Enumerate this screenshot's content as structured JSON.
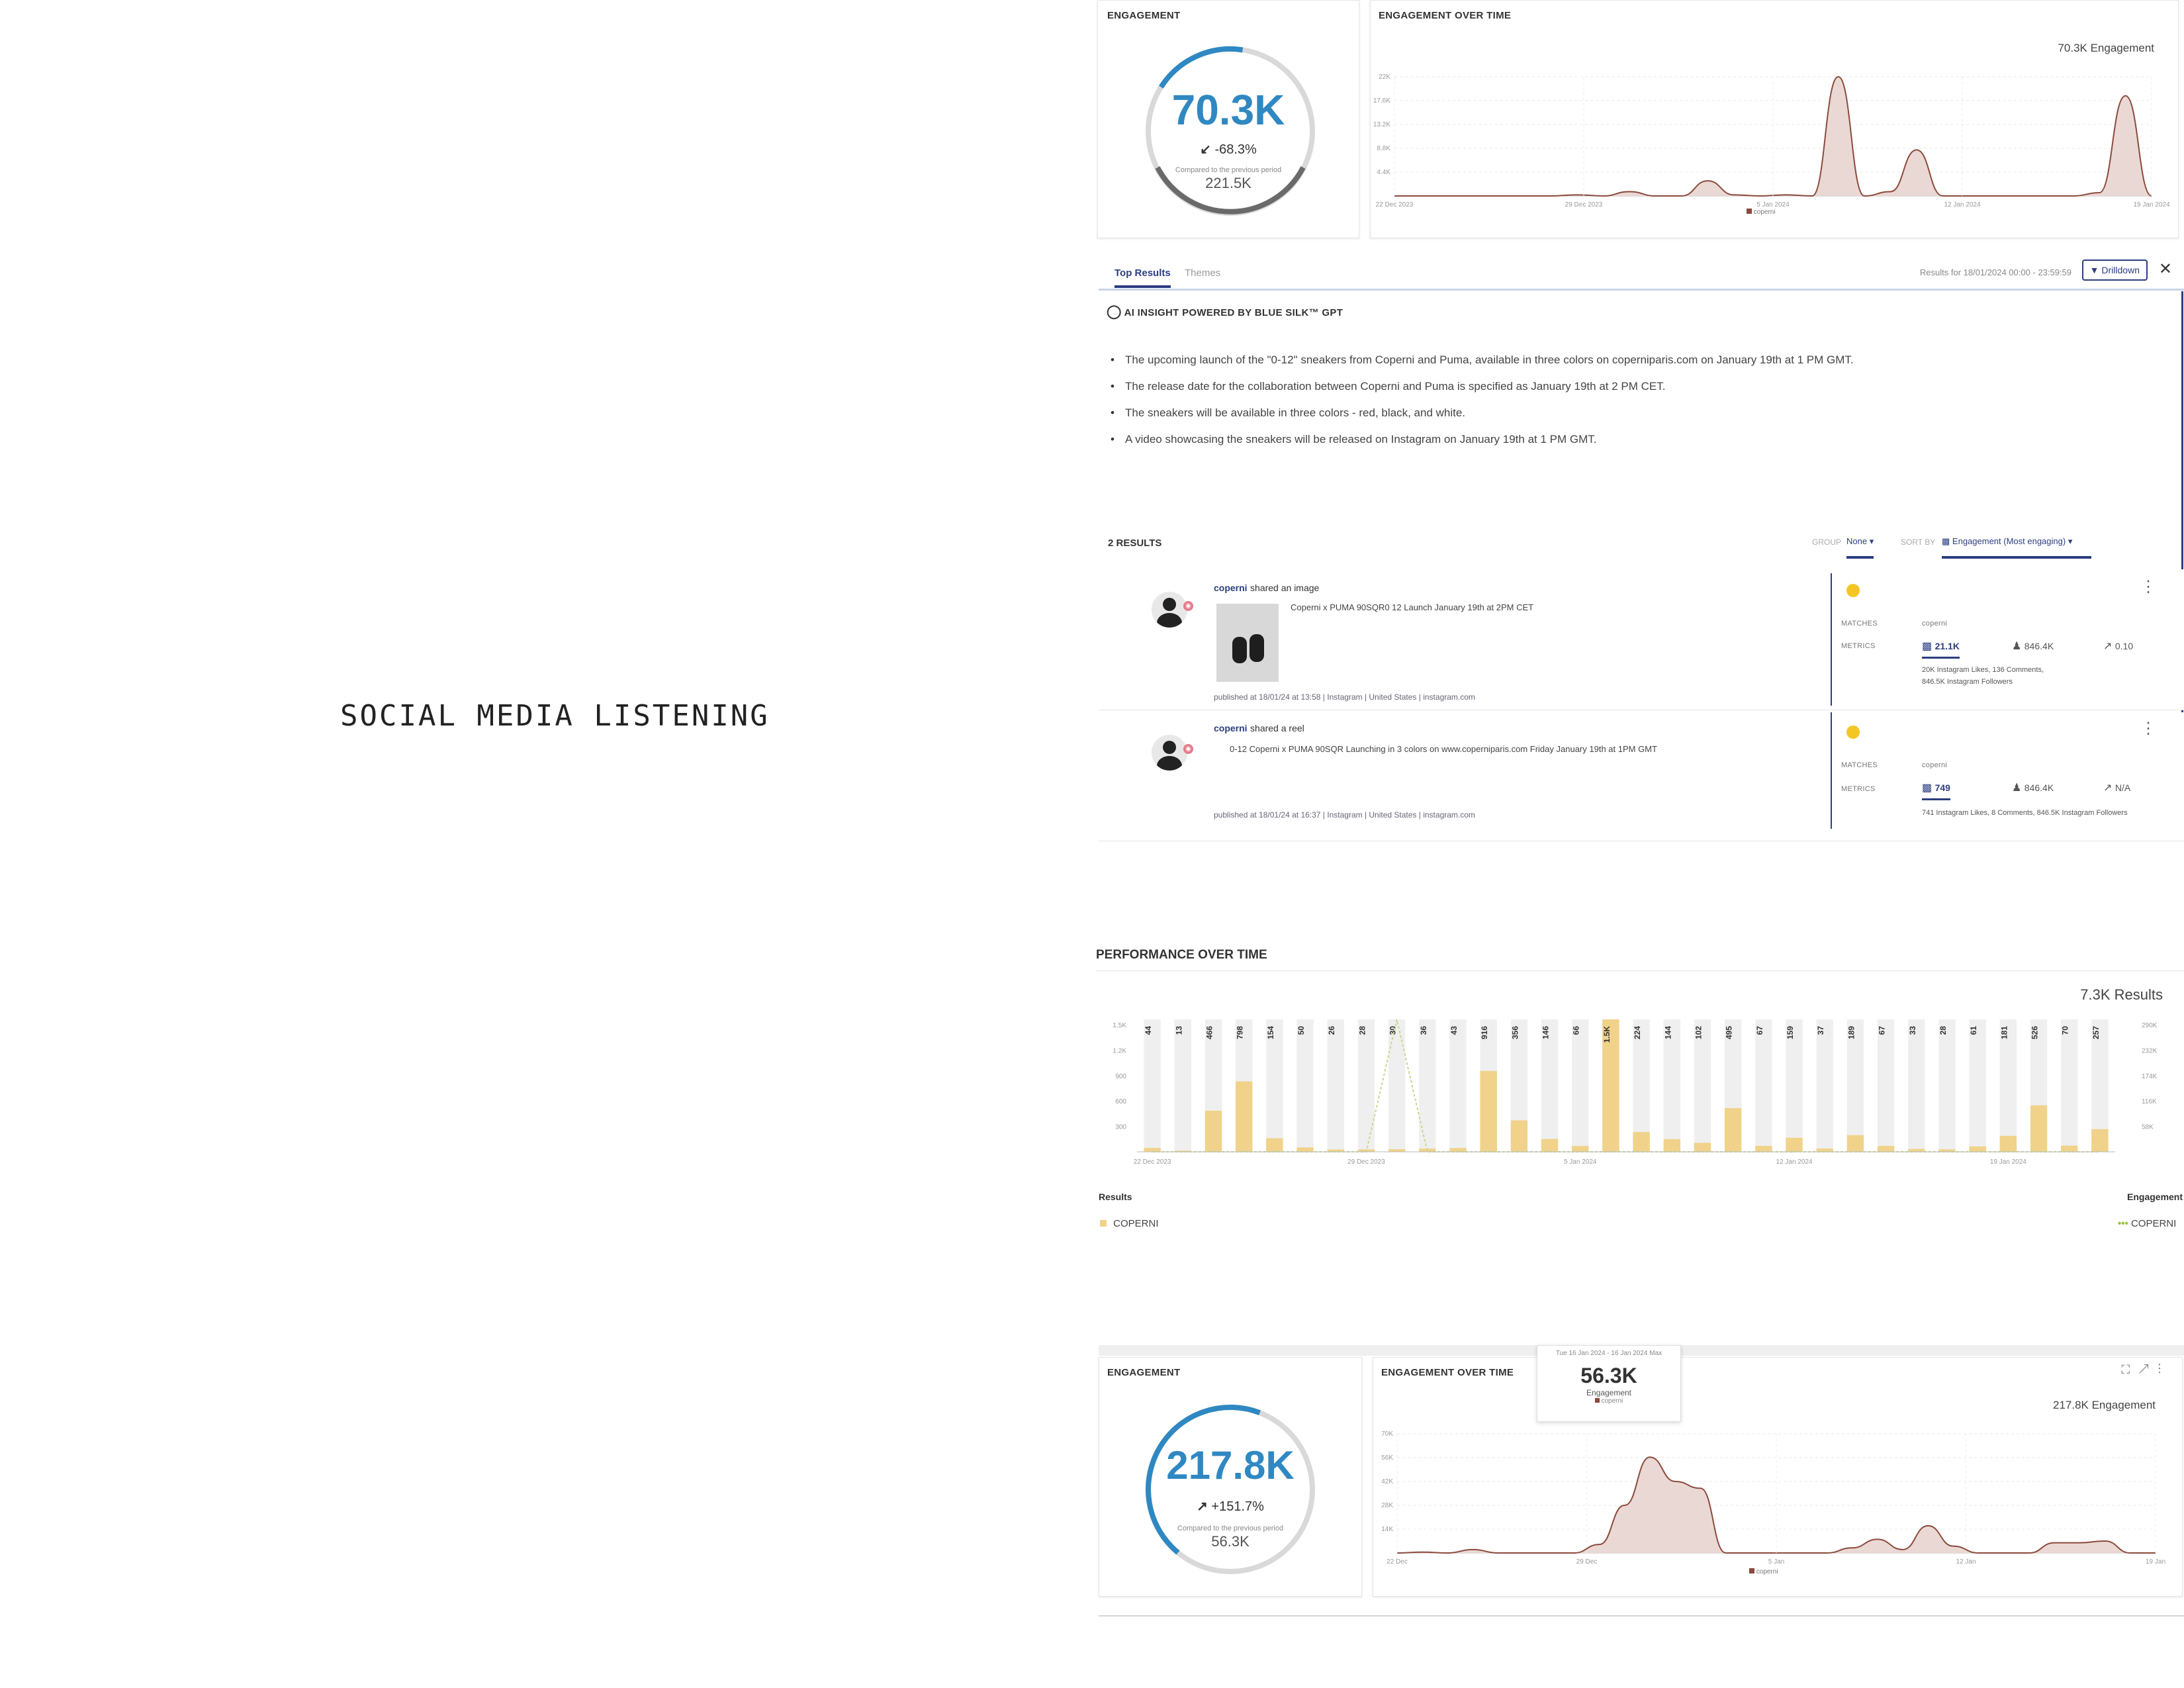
{
  "page_title": "SOCIAL MEDIA LISTENING",
  "top_panel": {
    "engagement_title": "ENGAGEMENT",
    "gauge": {
      "value": "70.3K",
      "change": "-68.3%",
      "compared_label": "Compared to the previous period",
      "previous_value": "221.5K",
      "arc_fraction": 0.32
    },
    "over_time_title": "ENGAGEMENT OVER TIME",
    "over_time_summary": "70.3K Engagement",
    "y_ticks": [
      "22K",
      "17.6K",
      "13.2K",
      "8.8K",
      "4.4K"
    ],
    "x_ticks": [
      "22 Dec 2023",
      "29 Dec 2023",
      "5 Jan 2024",
      "12 Jan 2024",
      "19 Jan 2024"
    ],
    "legend": "coperni"
  },
  "results_panel": {
    "tabs": [
      "Top Results",
      "Themes"
    ],
    "results_for": "Results for 18/01/2024 00:00 - 23:59:59",
    "filter_label": "Drilldown",
    "insight_title": "AI INSIGHT POWERED BY BLUE SILK™ GPT",
    "bullets": [
      "The upcoming launch of the \"0-12\" sneakers from Coperni and Puma, available in three colors on coperniparis.com on January 19th at 1 PM GMT.",
      "The release date for the collaboration between Coperni and Puma is specified as January 19th at 2 PM CET.",
      "The sneakers will be available in three colors - red, black, and white.",
      "A video showcasing the sneakers will be released on Instagram on January 19th at 1 PM GMT."
    ],
    "results_count": "2 RESULTS",
    "group_label": "GROUP",
    "group_value": "None",
    "sort_label": "SORT BY",
    "sort_value": "Engagement (Most engaging)",
    "posts": [
      {
        "author": "coperni",
        "action": "shared an image",
        "text": "Coperni x PUMA 90SQR0 12 Launch January 19th at 2PM CET",
        "published": "published at 18/01/24 at 13:58 | Instagram | United States | instagram.com",
        "matches_label": "MATCHES",
        "matches_value": "coperni",
        "metrics_label": "METRICS",
        "engagement": "21.1K",
        "followers": "846.4K",
        "ratio": "0.10",
        "details_line1": "20K Instagram Likes, 136 Comments,",
        "details_line2": "846.5K Instagram Followers"
      },
      {
        "author": "coperni",
        "action": "shared a reel",
        "text": "0-12 Coperni x PUMA 90SQR Launching in 3 colors on www.coperniparis.com Friday January 19th at 1PM GMT",
        "published": "published at 18/01/24 at 16:37 | Instagram | United States | instagram.com",
        "matches_label": "MATCHES",
        "matches_value": "coperni",
        "metrics_label": "METRICS",
        "engagement": "749",
        "followers": "846.4K",
        "ratio": "N/A",
        "details_line1": "741 Instagram Likes, 8 Comments, 846.5K Instagram Followers",
        "details_line2": ""
      }
    ]
  },
  "performance": {
    "title": "PERFORMANCE OVER TIME",
    "summary": "7.3K Results",
    "results_legend_title": "Results",
    "engagement_legend_title": "Engagement",
    "results_legend": "COPERNI",
    "engagement_legend": "COPERNI",
    "colors": {
      "bar": "#f0d28a",
      "bar_bg": "#efefef",
      "line": "#c8d890"
    },
    "y_left_ticks": [
      "1.5K",
      "1.2K",
      "900",
      "600",
      "300"
    ],
    "y_right_ticks": [
      "290K",
      "232K",
      "174K",
      "116K",
      "58K"
    ]
  },
  "bottom_panel": {
    "engagement_title": "ENGAGEMENT",
    "gauge": {
      "value": "217.8K",
      "change": "+151.7%",
      "compared_label": "Compared to the previous period",
      "previous_value": "56.3K",
      "arc_fraction": 0.78
    },
    "over_time_title": "ENGAGEMENT OVER TIME",
    "over_time_summary": "217.8K Engagement",
    "tooltip": {
      "date": "Tue 16 Jan 2024 - 16 Jan 2024 Max",
      "value": "56.3K",
      "label": "Engagement",
      "series": "coperni"
    },
    "y_ticks": [
      "70K",
      "56K",
      "42K",
      "28K",
      "14K"
    ],
    "x_ticks": [
      "22 Dec",
      "29 Dec",
      "5 Jan",
      "12 Jan",
      "19 Jan"
    ],
    "legend": "coperni"
  },
  "chart_data": [
    {
      "type": "area",
      "title": "ENGAGEMENT OVER TIME",
      "x": [
        "22 Dec 2023",
        "23 Dec",
        "24 Dec",
        "25 Dec",
        "26 Dec",
        "27 Dec",
        "28 Dec",
        "29 Dec 2023",
        "30 Dec",
        "31 Dec",
        "1 Jan",
        "2 Jan",
        "3 Jan",
        "4 Jan",
        "5 Jan 2024",
        "6 Jan",
        "7 Jan",
        "8 Jan",
        "9 Jan",
        "10 Jan",
        "11 Jan",
        "12 Jan 2024",
        "13 Jan",
        "14 Jan",
        "15 Jan",
        "16 Jan",
        "17 Jan",
        "18 Jan",
        "19 Jan 2024",
        "20 Jan"
      ],
      "series": [
        {
          "name": "coperni",
          "values": [
            0,
            0,
            0,
            0,
            0,
            0,
            0,
            200,
            0,
            800,
            0,
            0,
            2800,
            200,
            0,
            200,
            0,
            22000,
            0,
            800,
            8500,
            0,
            0,
            0,
            0,
            0,
            0,
            600,
            18500,
            0
          ]
        }
      ],
      "ylim": [
        0,
        22000
      ]
    },
    {
      "type": "bar",
      "title": "PERFORMANCE OVER TIME",
      "categories": [
        "22 Dec 2023",
        "23 Dec",
        "24 Dec",
        "25 Dec",
        "26 Dec",
        "27 Dec",
        "28 Dec",
        "29 Dec 2023",
        "30 Dec",
        "31 Dec",
        "1 Jan",
        "2 Jan",
        "3 Jan",
        "4 Jan",
        "5 Jan 2024",
        "6 Jan",
        "7 Jan",
        "8 Jan",
        "9 Jan",
        "10 Jan",
        "11 Jan",
        "12 Jan 2024",
        "13 Jan",
        "14 Jan",
        "15 Jan",
        "16 Jan",
        "17 Jan",
        "18 Jan",
        "19 Jan 2024",
        "20 Jan",
        "21 Jan",
        "22 Jan",
        "23 Jan"
      ],
      "series": [
        {
          "name": "COPERNI",
          "values": [
            44,
            13,
            466,
            798,
            154,
            50,
            26,
            28,
            30,
            36,
            43,
            916,
            356,
            146,
            66,
            1500,
            224,
            144,
            102,
            495,
            67,
            159,
            37,
            189,
            67,
            33,
            28,
            61,
            181,
            526,
            70,
            257
          ]
        },
        {
          "name": "COPERNI",
          "values": [
            0,
            0,
            0,
            0,
            0,
            0,
            0,
            0,
            290000,
            0,
            0,
            0,
            0,
            0,
            0,
            0,
            0,
            0,
            0,
            0,
            0,
            0,
            0,
            0,
            0,
            0,
            0,
            0,
            0,
            0,
            0,
            0
          ]
        }
      ],
      "ylim": [
        0,
        1500
      ],
      "ylim_right": [
        0,
        290000
      ]
    },
    {
      "type": "area",
      "title": "ENGAGEMENT OVER TIME",
      "x": [
        "22 Dec",
        "23 Dec",
        "24 Dec",
        "25 Dec",
        "26 Dec",
        "27 Dec",
        "28 Dec",
        "29 Dec",
        "30 Dec",
        "31 Dec",
        "1 Jan",
        "2 Jan",
        "3 Jan",
        "4 Jan",
        "5 Jan",
        "6 Jan",
        "7 Jan",
        "8 Jan",
        "9 Jan",
        "10 Jan",
        "11 Jan",
        "12 Jan",
        "13 Jan",
        "14 Jan",
        "15 Jan",
        "16 Jan",
        "17 Jan",
        "18 Jan",
        "19 Jan",
        "20 Jan",
        "21 Jan"
      ],
      "series": [
        {
          "name": "coperni",
          "values": [
            0,
            500,
            0,
            2000,
            0,
            0,
            0,
            0,
            5000,
            28000,
            56300,
            42000,
            38000,
            0,
            0,
            0,
            0,
            0,
            3000,
            8000,
            2000,
            16000,
            4000,
            0,
            0,
            0,
            6000,
            6000,
            7000,
            0,
            0
          ]
        }
      ],
      "ylim": [
        0,
        70000
      ]
    }
  ]
}
